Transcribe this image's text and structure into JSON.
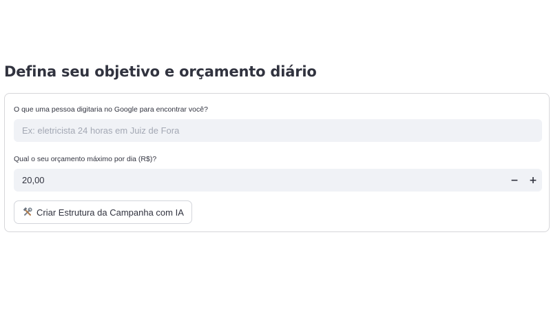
{
  "section": {
    "title": "Defina seu objetivo e orçamento diário"
  },
  "form": {
    "goal_field": {
      "label": "O que uma pessoa digitaria no Google para encontrar você?",
      "value": "",
      "placeholder": "Ex: eletricista 24 horas em Juiz de Fora"
    },
    "budget_field": {
      "label": "Qual o seu orçamento máximo por dia (R$)?",
      "value": "20,00",
      "decrement_label": "−",
      "increment_label": "+"
    },
    "submit_button": {
      "icon": "hammer-and-wrench-icon",
      "label": "Criar Estrutura da Campanha com IA"
    }
  },
  "colors": {
    "input_background": "#f0f2f6",
    "card_border": "#d6d6d9",
    "text": "#31333f",
    "placeholder": "#a3a8b4"
  }
}
